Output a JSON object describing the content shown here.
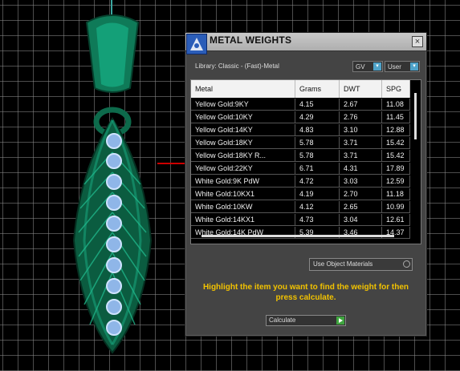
{
  "window": {
    "title": "METAL WEIGHTS",
    "close_icon": "close-icon"
  },
  "library": {
    "label": "Library: Classic - (Fast)-Metal"
  },
  "dropdowns": {
    "units": "GV",
    "user": "User"
  },
  "table": {
    "headers": [
      "Metal",
      "Grams",
      "DWT",
      "SPG"
    ],
    "rows": [
      {
        "metal": "Yellow Gold:9KY",
        "grams": "4.15",
        "dwt": "2.67",
        "spg": "11.08"
      },
      {
        "metal": "Yellow Gold:10KY",
        "grams": "4.29",
        "dwt": "2.76",
        "spg": "11.45"
      },
      {
        "metal": "Yellow Gold:14KY",
        "grams": "4.83",
        "dwt": "3.10",
        "spg": "12.88"
      },
      {
        "metal": "Yellow Gold:18KY",
        "grams": "5.78",
        "dwt": "3.71",
        "spg": "15.42"
      },
      {
        "metal": "Yellow Gold:18KY R...",
        "grams": "5.78",
        "dwt": "3.71",
        "spg": "15.42"
      },
      {
        "metal": "Yellow Gold:22KY",
        "grams": "6.71",
        "dwt": "4.31",
        "spg": "17.89"
      },
      {
        "metal": "White Gold:9K PdW",
        "grams": "4.72",
        "dwt": "3.03",
        "spg": "12.59"
      },
      {
        "metal": "White Gold:10KX1",
        "grams": "4.19",
        "dwt": "2.70",
        "spg": "11.18"
      },
      {
        "metal": "White Gold:10KW",
        "grams": "4.12",
        "dwt": "2.65",
        "spg": "10.99"
      },
      {
        "metal": "White Gold:14KX1",
        "grams": "4.73",
        "dwt": "3.04",
        "spg": "12.61"
      },
      {
        "metal": "White Gold:14K PdW",
        "grams": "5.39",
        "dwt": "3.46",
        "spg": "14.37"
      }
    ]
  },
  "use_object_materials": "Use Object Materials",
  "instructions": "Highlight the item you want to find the weight for then press calculate.",
  "calculate": {
    "label": "Calculate"
  }
}
